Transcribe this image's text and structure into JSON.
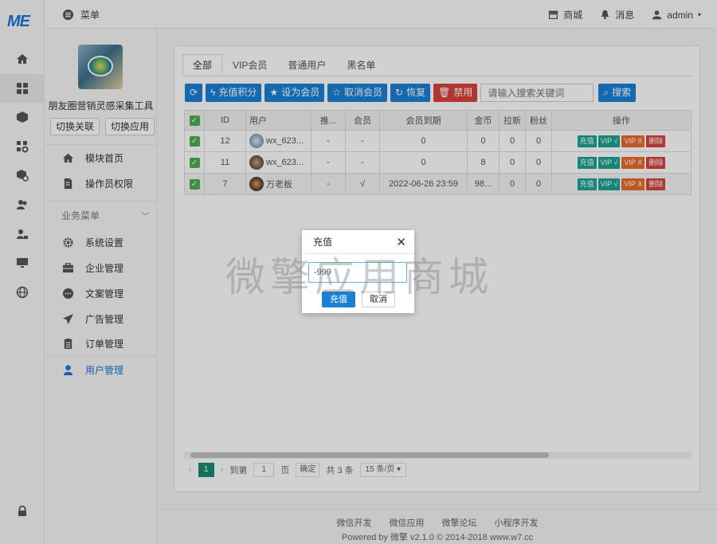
{
  "rail": {
    "logo": "ME",
    "icons": [
      "home-icon",
      "grid-icon",
      "cube-icon",
      "apps-settings-icon",
      "box-settings-icon",
      "users-icon",
      "user-lock-icon",
      "monitor-icon",
      "globe-icon",
      "lock-icon"
    ],
    "active_index": 1
  },
  "topbar": {
    "menu_label": "菜单",
    "store_label": "商城",
    "messages_label": "消息",
    "user_label": "admin"
  },
  "sidebar": {
    "app_name": "朋友圈营销灵感采集工具",
    "btn_switch_link": "切换关联",
    "btn_switch_app": "切换应用",
    "items_top": [
      {
        "label": "模块首页",
        "icon": "home-icon"
      },
      {
        "label": "操作员权限",
        "icon": "document-edit-icon"
      }
    ],
    "group_label": "业务菜单",
    "items": [
      {
        "label": "系统设置",
        "icon": "gear-icon"
      },
      {
        "label": "企业管理",
        "icon": "briefcase-icon"
      },
      {
        "label": "文案管理",
        "icon": "ellipsis-icon"
      },
      {
        "label": "广告管理",
        "icon": "paper-plane-icon"
      },
      {
        "label": "订单管理",
        "icon": "clipboard-icon"
      },
      {
        "label": "用户管理",
        "icon": "user-icon",
        "active": true
      }
    ]
  },
  "tabs": [
    "全部",
    "VIP会员",
    "普通用户",
    "黑名单"
  ],
  "toolbar": {
    "refresh": "",
    "recharge": "充值积分",
    "set_member": "设为会员",
    "cancel_member": "取消会员",
    "restore": "恢复",
    "ban": "禁用",
    "search_placeholder": "请输入搜索关键词",
    "search_btn": "搜索"
  },
  "table": {
    "headers": [
      "",
      "ID",
      "用户",
      "推...",
      "会员",
      "会员到期",
      "金币",
      "拉新",
      "粉丝",
      "操作"
    ],
    "rows": [
      {
        "id": "12",
        "user": "wx_623...",
        "ref": "-",
        "member": "-",
        "expire": "0",
        "coins": "0",
        "new": "0",
        "fans": "0"
      },
      {
        "id": "11",
        "user": "wx_623...",
        "ref": "-",
        "member": "-",
        "expire": "0",
        "coins": "8",
        "new": "0",
        "fans": "0"
      },
      {
        "id": "7",
        "user": "万老板",
        "ref": "-",
        "member": "√",
        "expire": "2022-06-26 23:59",
        "coins": "98...",
        "new": "0",
        "fans": "0"
      }
    ],
    "ops": {
      "recharge": "充值",
      "vip_on": "VIP √",
      "vip_off": "VIP X",
      "delete": "删除"
    }
  },
  "pager": {
    "current": "1",
    "goto_label": "到第",
    "goto_value": "1",
    "page_unit": "页",
    "confirm": "确定",
    "total": "共 3 条",
    "per_page": "15 条/页"
  },
  "footer": {
    "links": [
      "微信开发",
      "微信应用",
      "微擎论坛",
      "小程序开发"
    ],
    "copyright": "Powered by 微擎 v2.1.0 © 2014-2018 www.w7.cc"
  },
  "modal": {
    "title": "充值",
    "value": "-999",
    "ok": "充值",
    "cancel": "取消"
  },
  "watermark": "微擎应用商城",
  "colors": {
    "primary": "#1a80d6",
    "danger": "#d9433b",
    "teal": "#1aa394",
    "orange": "#ec6b2d",
    "check": "#4caf50",
    "pager_active": "#1a8c6e"
  }
}
